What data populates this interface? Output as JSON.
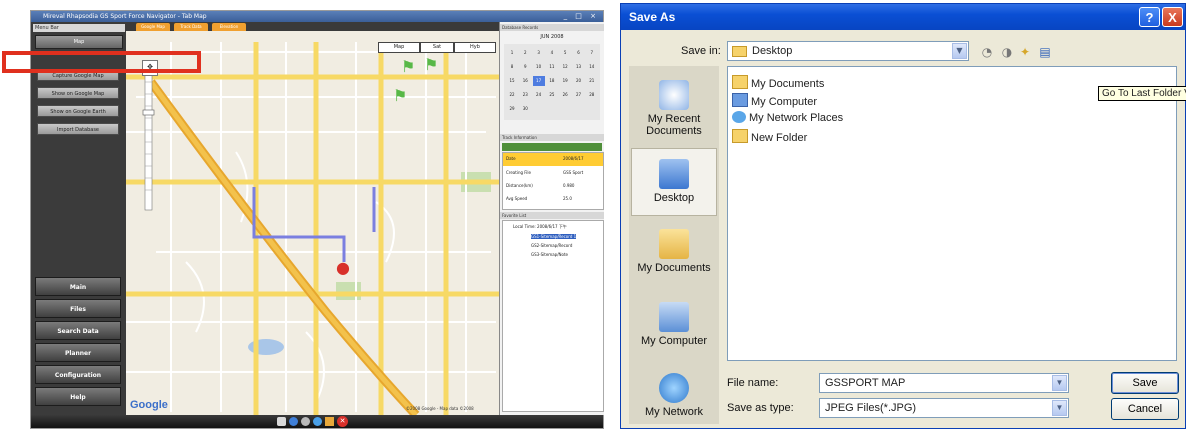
{
  "app": {
    "title": "Mireval Rhapsodia GS Sport Force Navigator - Tab Map",
    "window_buttons": "_ □ ×",
    "menu_header": "Menu Bar",
    "segment_label": "Map",
    "side_buttons": [
      "Capture Google Map",
      "Show on Google Map",
      "Show on Google Earth",
      "Import Database"
    ],
    "nav_buttons": [
      "Main",
      "Files",
      "Search Data",
      "Planner",
      "Configuration",
      "Help"
    ],
    "map_tabs": [
      "Google Map",
      "Track Data",
      "Elevation"
    ],
    "map_type_buttons": [
      "Map",
      "Sat",
      "Hyb"
    ],
    "map_logo": "Google",
    "map_footer": "©2008 Google - Map data ©2008",
    "panel_headers": [
      "Database Records",
      "Track Information",
      "Favorite List"
    ],
    "calendar_month": "JUN 2008",
    "calendar_days": [
      "1",
      "2",
      "3",
      "4",
      "5",
      "6",
      "7",
      "8",
      "9",
      "10",
      "11",
      "12",
      "13",
      "14",
      "15",
      "16",
      "17",
      "18",
      "19",
      "20",
      "21",
      "22",
      "23",
      "24",
      "25",
      "26",
      "27",
      "28",
      "29",
      "30"
    ],
    "track_info": [
      {
        "k": "Date",
        "v": "2008/6/17"
      },
      {
        "k": "Creating File",
        "v": "GSS Sport"
      },
      {
        "k": "Distance(km)",
        "v": "0.980"
      },
      {
        "k": "Avg Speed",
        "v": "25.0"
      }
    ],
    "tree_root": "Local Time: 2008/6/17 下午",
    "tree_items": [
      "GS1-Sitemap/Record 1",
      "GS2-Sitemap/Record",
      "GS3-Sitemap/Note"
    ],
    "highlight_color": "#e0301e"
  },
  "dialog": {
    "title": "Save As",
    "help_label": "?",
    "close_label": "X",
    "save_in_label": "Save in:",
    "save_in_value": "Desktop",
    "places": [
      "My Recent Documents",
      "Desktop",
      "My Documents",
      "My Computer",
      "My Network"
    ],
    "files": [
      "My Documents",
      "My Computer",
      "My Network Places",
      "New Folder"
    ],
    "tooltip": "Go To Last Folder Visited",
    "file_name_label": "File name:",
    "file_name_value": "GSSPORT MAP",
    "save_type_label": "Save as type:",
    "save_type_value": "JPEG Files(*.JPG)",
    "save_button": "Save",
    "cancel_button": "Cancel",
    "title_bar_color": "#0a4fd4"
  }
}
